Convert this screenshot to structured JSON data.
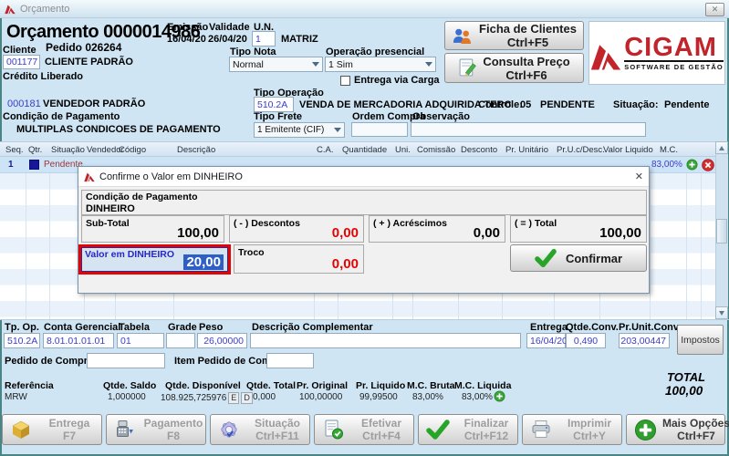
{
  "window": {
    "title": "Orçamento"
  },
  "icons": {
    "close": "✕"
  },
  "header": {
    "order_title": "Orçamento 0000014986",
    "pedido": "Pedido 026264",
    "cliente_label": "Cliente",
    "cliente_code": "001177",
    "cliente_name": "CLIENTE PADRÃO",
    "credito": "Crédito Liberado",
    "emissao_label": "Emissão",
    "emissao": "16/04/20",
    "validade_label": "Validade",
    "validade": "26/04/20",
    "un_label": "U.N.",
    "un": "1",
    "un_name": "MATRIZ",
    "tipo_nota_label": "Tipo Nota",
    "tipo_nota": "Normal",
    "operacao_label": "Operação presencial",
    "operacao": "1 Sim",
    "entrega_carga": "Entrega via Carga",
    "ficha_btn": "Ficha de Clientes",
    "ficha_key": "Ctrl+F5",
    "consulta_btn": "Consulta Preço",
    "consulta_key": "Ctrl+F6",
    "logo_name": "CIGAM",
    "logo_tagline": "SOFTWARE DE GESTÃO"
  },
  "info": {
    "vendedor_code": "000181",
    "vendedor": "VENDEDOR PADRÃO",
    "tipo_operacao_label": "Tipo Operação",
    "tipo_operacao": "510.2A",
    "tipo_operacao_desc": "VENDA DE MERCADORIA ADQUIRIDA TERC",
    "controle_label": "Controle:",
    "controle": "05",
    "controle_status": "PENDENTE",
    "situacao_label": "Situação:",
    "situacao": "Pendente",
    "cond_pag_label": "Condição de Pagamento",
    "cond_pag": "MULTIPLAS CONDICOES DE PAGAMENTO",
    "tipo_frete_label": "Tipo Frete",
    "tipo_frete": "1 Emitente (CIF)",
    "ordem_compra_label": "Ordem Compra",
    "observacao_label": "Observação"
  },
  "table": {
    "columns": [
      "Seq.",
      "Qtr.",
      "Situação",
      "Vendedor",
      "Código",
      "Descrição",
      "C.A.",
      "Quantidade",
      "Uni.",
      "Comissão",
      "Desconto",
      "Pr. Unitário",
      "Pr.U.c/Desc.",
      "Valor Liquido",
      "M.C."
    ],
    "row1": {
      "seq": "1",
      "situacao": "Pendente",
      "mc": "83,00%"
    }
  },
  "dialog": {
    "title": "Confirme o Valor em DINHEIRO",
    "cond_label": "Condição de Pagamento",
    "cond_value": "DINHEIRO",
    "subtotal_label": "Sub-Total",
    "subtotal": "100,00",
    "descontos_label": "( - ) Descontos",
    "descontos": "0,00",
    "acrescimos_label": "( + ) Acréscimos",
    "acrescimos": "0,00",
    "total_label": "( = ) Total",
    "total": "100,00",
    "valor_label": "Valor em DINHEIRO",
    "valor": "20,00",
    "troco_label": "Troco",
    "troco": "0,00",
    "confirm_label": "Confirmar"
  },
  "details": {
    "tp_op_label": "Tp. Op.",
    "tp_op": "510.2A",
    "conta_label": "Conta Gerencial",
    "conta": "8.01.01.01.01",
    "tabela_label": "Tabela",
    "tabela": "01",
    "grade_label": "Grade",
    "peso_label": "Peso",
    "peso": "26,00000",
    "desc_comp_label": "Descrição Complementar",
    "entrega_label": "Entrega",
    "entrega": "16/04/20",
    "qtde_conv_label": "Qtde.Conv.",
    "qtde_conv": "0,490",
    "pr_unit_conv_label": "Pr.Unit.Conv.",
    "pr_unit_conv": "203,00447",
    "impostos_btn": "Impostos",
    "pedido_compra_label": "Pedido de Compra",
    "item_pedido_label": "Item Pedido de Compra"
  },
  "summary": {
    "referencia_label": "Referência",
    "referencia": "MRW",
    "qtde_saldo_label": "Qtde. Saldo",
    "qtde_saldo": "1,000000",
    "qtde_disp_label": "Qtde. Disponível",
    "qtde_disp": "108.925,725976",
    "flag_e": "E",
    "flag_d": "D",
    "qtde_total_label": "Qtde. Total",
    "qtde_total": "0,000",
    "pr_original_label": "Pr. Original",
    "pr_original": "100,00000",
    "pr_liquido_label": "Pr. Liquido",
    "pr_liquido": "99,99500",
    "mc_bruta_label": "M.C. Bruta",
    "mc_bruta": "83,00%",
    "mc_liquida_label": "M.C. Liquida",
    "mc_liquida": "83,00%",
    "total_label": "TOTAL",
    "total": "100,00"
  },
  "toolbar": [
    {
      "label": "Entrega",
      "key": "F7"
    },
    {
      "label": "Pagamento",
      "key": "F8"
    },
    {
      "label": "Situação",
      "key": "Ctrl+F11"
    },
    {
      "label": "Efetivar",
      "key": "Ctrl+F4"
    },
    {
      "label": "Finalizar",
      "key": "Ctrl+F12"
    },
    {
      "label": "Imprimir",
      "key": "Ctrl+Y"
    },
    {
      "label": "Mais Opções",
      "key": "Ctrl+F7"
    }
  ],
  "colors": {
    "accent_blue_text": "#3d3dc8",
    "selected_row": "#cde4f7",
    "alert_red": "#e00404",
    "brand_red": "#c2242b",
    "window_border": "#4a8585"
  }
}
